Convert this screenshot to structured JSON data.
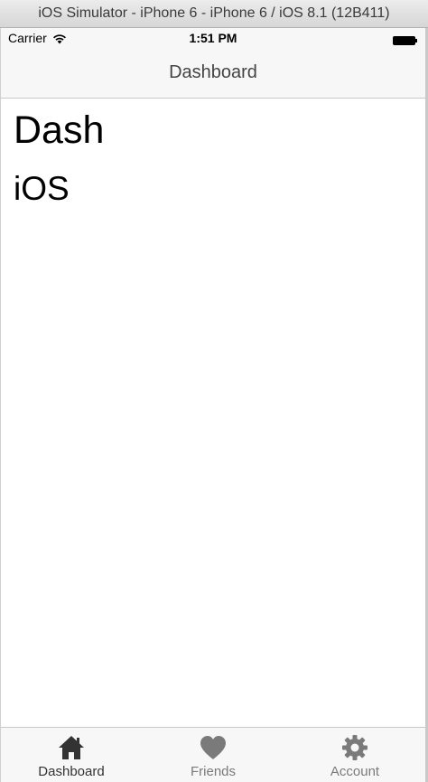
{
  "window": {
    "title": "iOS Simulator - iPhone 6 - iPhone 6 / iOS 8.1 (12B411)"
  },
  "status_bar": {
    "carrier": "Carrier",
    "time": "1:51 PM"
  },
  "nav_bar": {
    "title": "Dashboard"
  },
  "main": {
    "heading": "Dash",
    "subheading": "iOS"
  },
  "tab_bar": {
    "tabs": [
      {
        "label": "Dashboard",
        "icon": "home-icon",
        "active": true
      },
      {
        "label": "Friends",
        "icon": "heart-icon",
        "active": false
      },
      {
        "label": "Account",
        "icon": "gear-icon",
        "active": false
      }
    ]
  },
  "colors": {
    "active_tab": "#333333",
    "inactive_tab": "#7a7a7a",
    "bar_background": "#f7f7f7"
  }
}
